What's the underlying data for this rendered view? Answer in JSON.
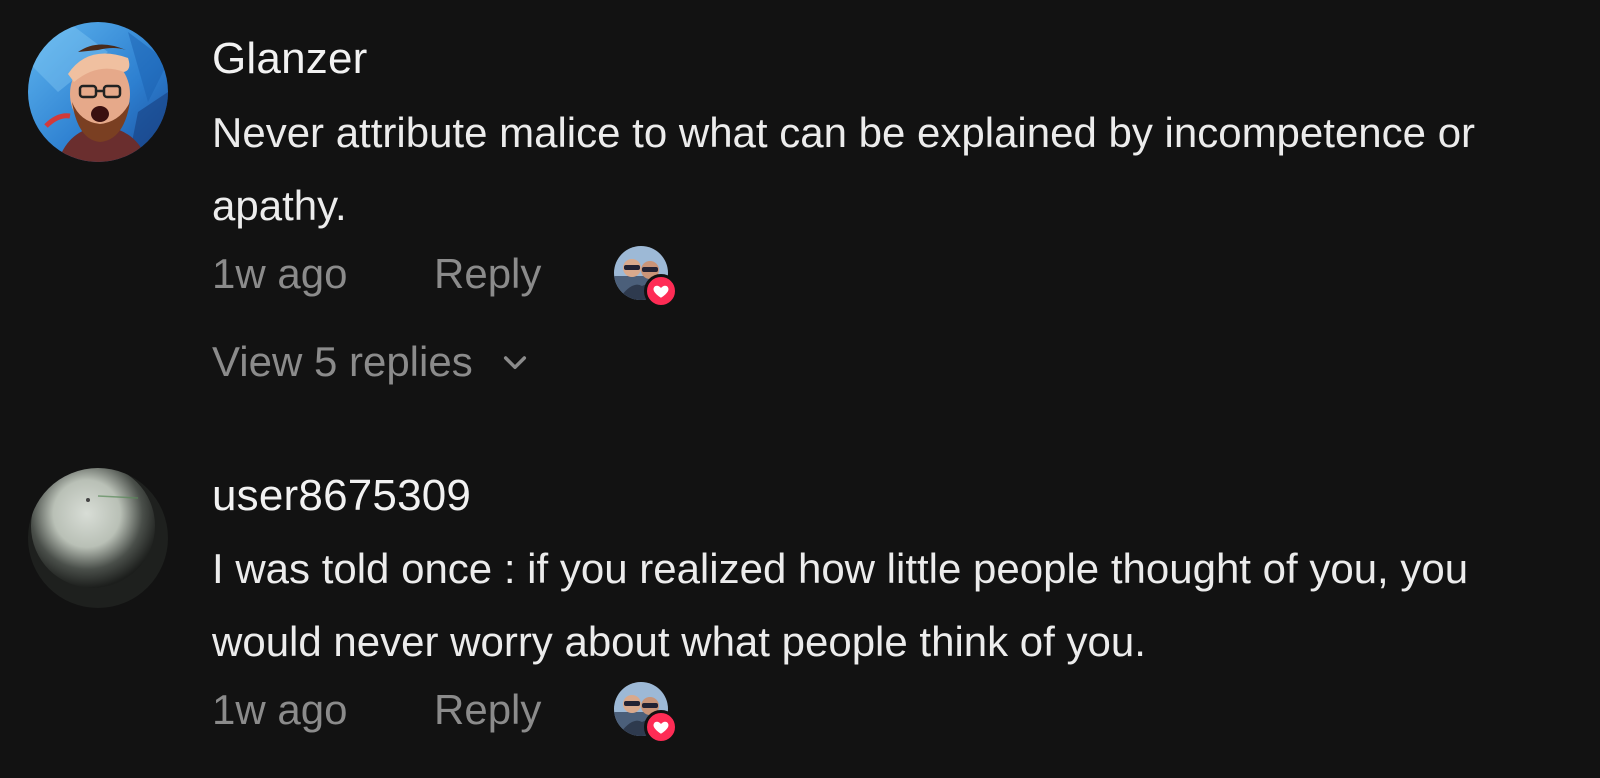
{
  "comments": [
    {
      "username": "Glanzer",
      "text": "Never attribute malice to what can be explained by incompetence or apathy.",
      "time": "1w ago",
      "reply_label": "Reply",
      "liked_by_creator": true,
      "view_replies_label": "View 5 replies",
      "avatar_icon": "avatar-glanzer"
    },
    {
      "username": "user8675309",
      "text": "I was told once : if you realized how little people thought of you, you would never worry about what people think of you.",
      "time": "1w ago",
      "reply_label": "Reply",
      "liked_by_creator": true,
      "avatar_icon": "avatar-user8675309"
    }
  ],
  "colors": {
    "background": "#121212",
    "primary_text": "#ececec",
    "secondary_text": "#8b8b8b",
    "heart_badge": "#fe2c55"
  }
}
